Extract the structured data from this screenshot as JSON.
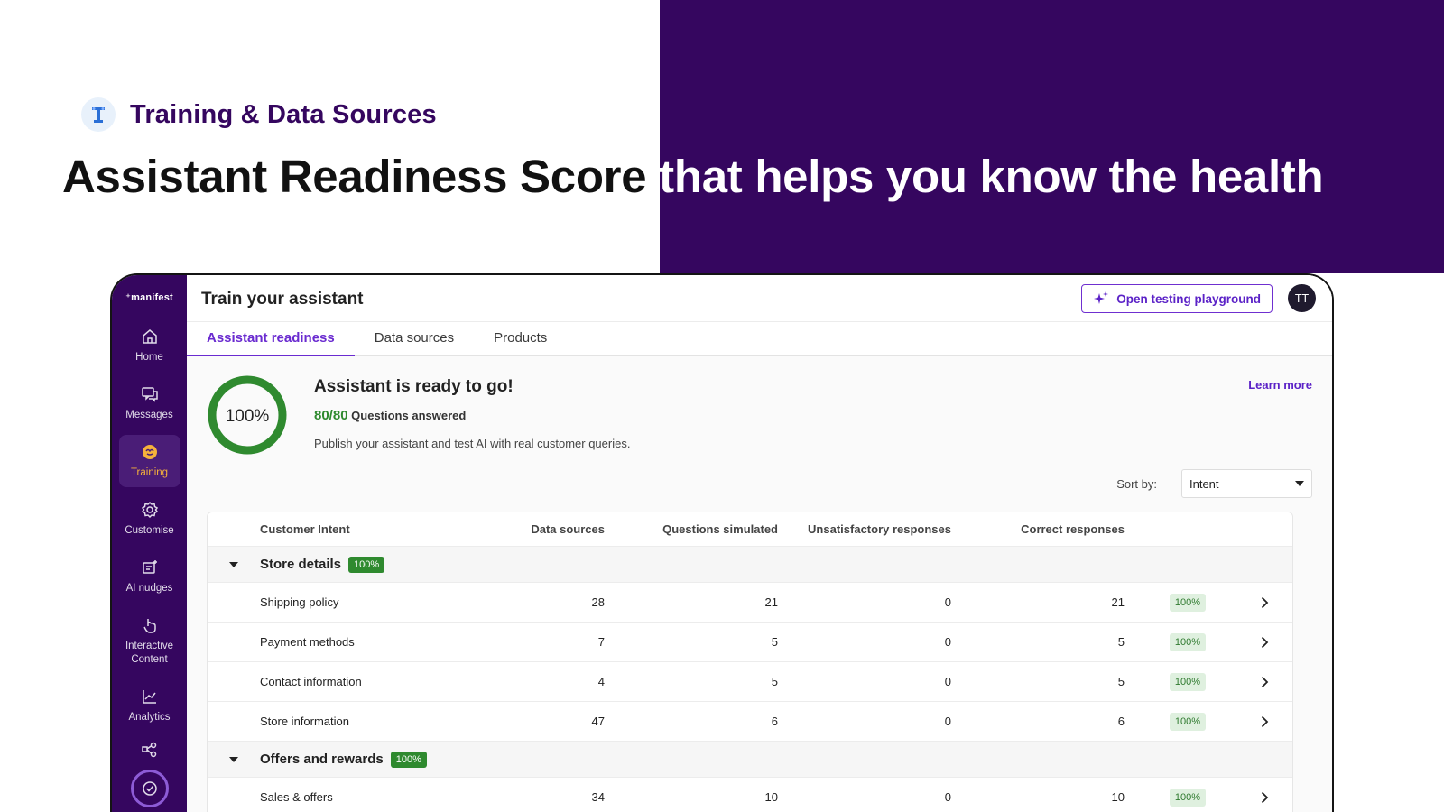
{
  "hero": {
    "section_title": "Training & Data Sources",
    "headline_dark": "Assistant Readiness Score",
    "headline_light": " that helps you know the health"
  },
  "app": {
    "logo": "⁺manifest",
    "page_title": "Train your assistant",
    "playground_button": "Open testing playground",
    "avatar_initials": "TT",
    "accent_color": "#35065f"
  },
  "sidebar": {
    "items": [
      {
        "label": "Home",
        "icon": "home-icon"
      },
      {
        "label": "Messages",
        "icon": "messages-icon"
      },
      {
        "label": "Training",
        "icon": "brain-icon",
        "active": true
      },
      {
        "label": "Customise",
        "icon": "gear-icon"
      },
      {
        "label": "AI nudges",
        "icon": "nudge-icon"
      },
      {
        "label": "Interactive Content",
        "icon": "pointer-icon"
      },
      {
        "label": "Analytics",
        "icon": "chart-icon"
      }
    ]
  },
  "tabs": [
    {
      "label": "Assistant readiness",
      "active": true
    },
    {
      "label": "Data sources"
    },
    {
      "label": "Products"
    }
  ],
  "readiness": {
    "score_text": "100%",
    "score_value": 100,
    "title": "Assistant is ready to go!",
    "answered_count": "80/80",
    "answered_label": " Questions answered",
    "description": "Publish your assistant and test AI with real customer queries.",
    "learn_more": "Learn more"
  },
  "sort": {
    "label": "Sort by:",
    "value": "Intent"
  },
  "table": {
    "headers": {
      "intent": "Customer Intent",
      "data_sources": "Data sources",
      "questions": "Questions simulated",
      "unsatisfactory": "Unsatisfactory responses",
      "correct": "Correct responses"
    },
    "groups": [
      {
        "name": "Store details",
        "badge": "100%",
        "rows": [
          {
            "intent": "Shipping policy",
            "data_sources": "28",
            "questions": "21",
            "unsatisfactory": "0",
            "correct": "21",
            "badge": "100%"
          },
          {
            "intent": "Payment methods",
            "data_sources": "7",
            "questions": "5",
            "unsatisfactory": "0",
            "correct": "5",
            "badge": "100%"
          },
          {
            "intent": "Contact information",
            "data_sources": "4",
            "questions": "5",
            "unsatisfactory": "0",
            "correct": "5",
            "badge": "100%"
          },
          {
            "intent": "Store information",
            "data_sources": "47",
            "questions": "6",
            "unsatisfactory": "0",
            "correct": "6",
            "badge": "100%"
          }
        ]
      },
      {
        "name": "Offers and rewards",
        "badge": "100%",
        "rows": [
          {
            "intent": "Sales & offers",
            "data_sources": "34",
            "questions": "10",
            "unsatisfactory": "0",
            "correct": "10",
            "badge": "100%"
          }
        ]
      }
    ]
  }
}
